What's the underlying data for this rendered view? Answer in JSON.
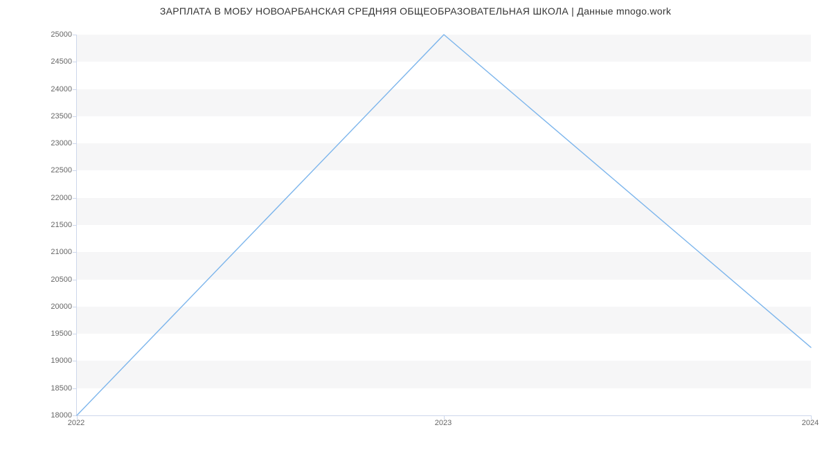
{
  "chart_data": {
    "type": "line",
    "title": "ЗАРПЛАТА В МОБУ НОВОАРБАНСКАЯ СРЕДНЯЯ ОБЩЕОБРАЗОВАТЕЛЬНАЯ ШКОЛА | Данные mnogo.work",
    "xlabel": "",
    "ylabel": "",
    "x": [
      2022,
      2023,
      2024
    ],
    "values": [
      18000,
      25000,
      19250
    ],
    "y_ticks": [
      18000,
      18500,
      19000,
      19500,
      20000,
      20500,
      21000,
      21500,
      22000,
      22500,
      23000,
      23500,
      24000,
      24500,
      25000
    ],
    "x_ticks": [
      "2022",
      "2023",
      "2024"
    ],
    "ylim": [
      18000,
      25000
    ],
    "xlim": [
      2022,
      2024
    ]
  }
}
